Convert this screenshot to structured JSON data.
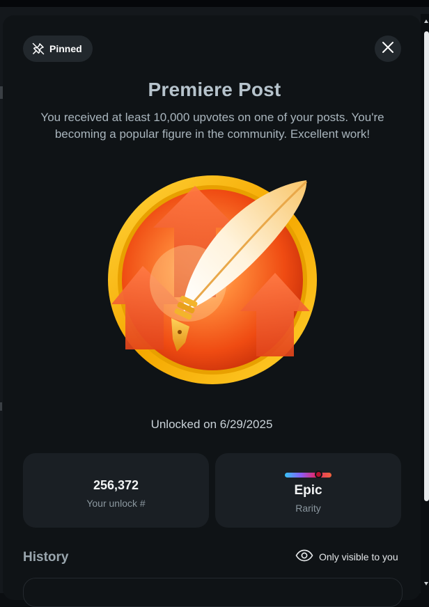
{
  "pinned": {
    "label": "Pinned"
  },
  "achievement": {
    "title": "Premiere Post",
    "description": "You received at least 10,000 upvotes on one of your posts. You're becoming a popular figure in the community. Excellent work!",
    "unlocked": "Unlocked on 6/29/2025",
    "badge_icon": "quill-upvote-badge"
  },
  "stats": {
    "unlock_number": "256,372",
    "unlock_label": "Your unlock #",
    "rarity_name": "Epic",
    "rarity_label": "Rarity",
    "rarity_level": 0.72
  },
  "history": {
    "heading": "History",
    "visibility_label": "Only visible to you",
    "visibility_icon": "eye-icon"
  },
  "colors": {
    "accent_gold": "#f5b400",
    "badge_orange": "#ef4b12",
    "rarity_marker": "#b3122e"
  }
}
